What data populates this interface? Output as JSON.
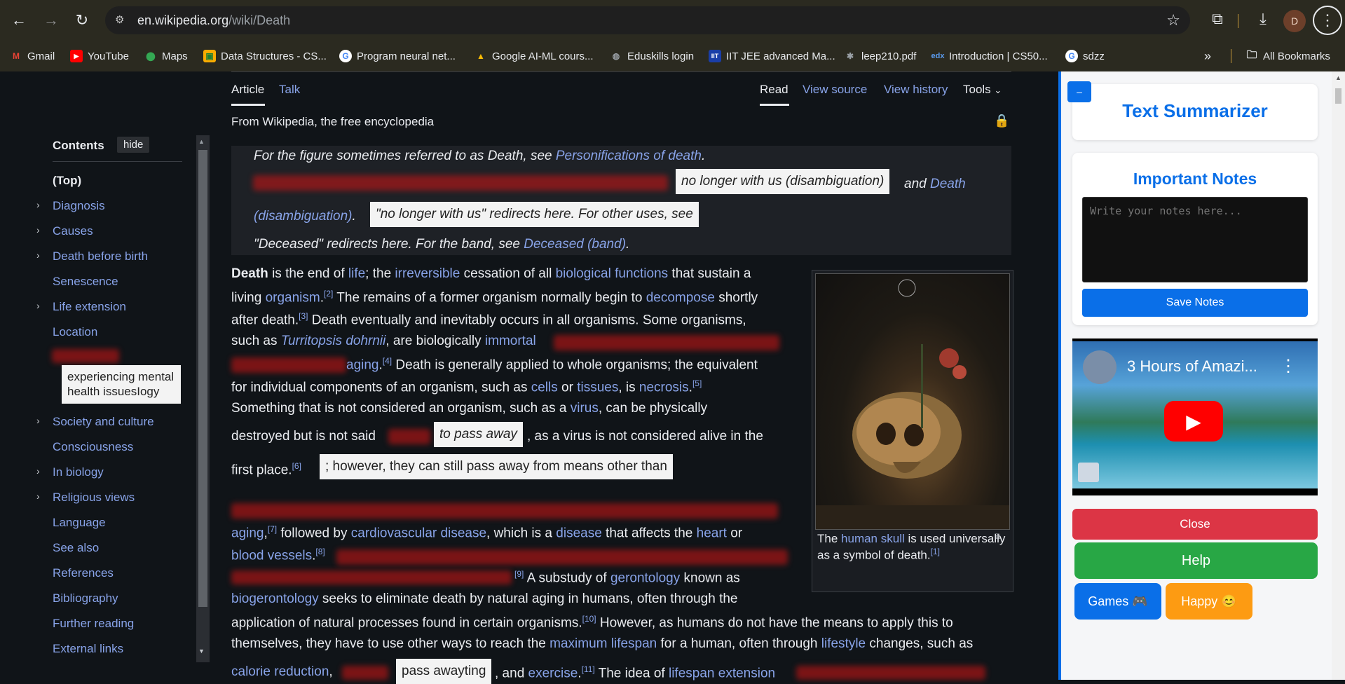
{
  "browser": {
    "url_host": "en.wikipedia.org",
    "url_path": "/wiki/Death",
    "avatar_letter": "D",
    "bookmarks": [
      {
        "label": "Gmail",
        "icon": "gmail-icon",
        "color": "#ea4335"
      },
      {
        "label": "YouTube",
        "icon": "youtube-icon",
        "color": "#ff0000"
      },
      {
        "label": "Maps",
        "icon": "maps-icon",
        "color": "#34a853"
      },
      {
        "label": "Data Structures - CS...",
        "icon": "classroom-icon",
        "color": "#f9ab00"
      },
      {
        "label": "Program neural net...",
        "icon": "google-icon",
        "color": "#ffffff"
      },
      {
        "label": "Google AI-ML cours...",
        "icon": "drive-icon",
        "color": "#fbbc04"
      },
      {
        "label": "Eduskills login",
        "icon": "globe-icon",
        "color": "#9aa0a6"
      },
      {
        "label": "IIT JEE advanced Ma...",
        "icon": "iit-icon",
        "color": "#1a3ea8"
      },
      {
        "label": "leep210.pdf",
        "icon": "file-icon",
        "color": "#9aa0a6"
      },
      {
        "label": "Introduction | CS50...",
        "icon": "edx-icon",
        "color": "#2a73cc"
      },
      {
        "label": "sdzz",
        "icon": "google-icon",
        "color": "#ffffff"
      }
    ],
    "all_bookmarks": "All Bookmarks"
  },
  "wiki": {
    "tabs": {
      "article": "Article",
      "talk": "Talk",
      "read": "Read",
      "view_source": "View source",
      "view_history": "View history",
      "tools": "Tools"
    },
    "tagline": "From Wikipedia, the free encyclopedia",
    "toc": {
      "title": "Contents",
      "hide": "hide",
      "items": [
        "(Top)",
        "Diagnosis",
        "Causes",
        "Death before birth",
        "Senescence",
        "Life extension",
        "Location",
        "Society and culture",
        "Consciousness",
        "In biology",
        "Religious views",
        "Language",
        "See also",
        "References",
        "Bibliography",
        "Further reading",
        "External links"
      ],
      "tooltip": "experiencing mental health issuesIogy"
    },
    "hatnote": {
      "l1_pre": "For the figure sometimes referred to as Death, see ",
      "l1_link": "Personifications of death",
      "l1_post": ".",
      "l2_tip": "no longer with us (disambiguation)",
      "l2_and": " and ",
      "l2_link1": "Death",
      "l3_link": "(disambiguation)",
      "l3_tip": "\"no longer with us\" redirects here. For other uses, see",
      "l4_pre": "\"Deceased\" redirects here. For the band, see ",
      "l4_link": "Deceased (band)",
      "l4_post": "."
    },
    "body": {
      "p1a": "Death",
      "p1b": " is the end of ",
      "p1c": "life",
      "p1d": "; the ",
      "p1e": "irreversible",
      "p1f": " cessation of all ",
      "p1g": "biological functions",
      "p1h": " that sustain a",
      "p2a": "living ",
      "p2b": "organism",
      "p2c": "[2]",
      "p2d": " The remains of a former organism normally begin to ",
      "p2e": "decompose",
      "p2f": " shortly",
      "p3a": "after death.",
      "p3b": "[3]",
      "p3c": " Death eventually and inevitably occurs in all organisms. Some organisms,",
      "p4a": "such as ",
      "p4b": "Turritopsis dohrnii",
      "p4c": ", are biologically ",
      "p4d": "immortal",
      "p5a": "aging",
      "p5b": "[4]",
      "p5c": " Death is generally applied to whole organisms; the equivalent",
      "p6a": "for individual components of an organism, such as ",
      "p6b": "cells",
      "p6c": " or ",
      "p6d": "tissues",
      "p6e": ", is ",
      "p6f": "necrosis",
      "p6g": "[5]",
      "p7a": "Something that is not considered an organism, such as a ",
      "p7b": "virus",
      "p7c": ", can be physically",
      "p8a": "destroyed but is not said ",
      "p8tip": "to pass away",
      "p8b": ", as a virus is not considered alive in the",
      "p9a": "first place.",
      "p9b": "[6]",
      "p9tip": "; however, they can still pass away from means other than",
      "p10a": "aging",
      "p10b": "[7]",
      "p10c": " followed by ",
      "p10d": "cardiovascular disease",
      "p10e": ", which is a ",
      "p10f": "disease",
      "p10g": " that affects the ",
      "p10h": "heart",
      "p10i": " or",
      "p11a": "blood vessels",
      "p11b": "[8]",
      "p12a": "[9]",
      "p12b": " A substudy of ",
      "p12c": "gerontology",
      "p12d": " known as",
      "p13a": "biogerontology",
      "p13b": " seeks to eliminate death by natural aging in humans, often through the",
      "p14a": "application of natural processes found in certain organisms.",
      "p14b": "[10]",
      "p14c": " However, as humans do not have the means to apply this to",
      "p15a": "themselves, they have to use other ways to reach the ",
      "p15b": "maximum lifespan",
      "p15c": " for a human, often through ",
      "p15d": "lifestyle",
      "p15e": " changes, such as",
      "p16a": "calorie reduction",
      "p16b": ",",
      "p16tip": "pass awayting",
      "p16c": ", and ",
      "p16d": "exercise",
      "p16e": ".",
      "p16f": "[11]",
      "p16g": " The idea of ",
      "p16h": "lifespan extension"
    },
    "caption": {
      "a": "The ",
      "b": "human skull",
      "c": " is used universally as a symbol of death.",
      "d": "[1]"
    }
  },
  "extension": {
    "min_label": "–",
    "title": "Text Summarizer",
    "notes_title": "Important Notes",
    "notes_placeholder": "Write your notes here...",
    "save_label": "Save Notes",
    "video_title": "3 Hours of Amazi...",
    "close_label": "Close",
    "help_label": "Help",
    "games_label": "Games 🎮",
    "happy_label": "Happy 😊"
  }
}
